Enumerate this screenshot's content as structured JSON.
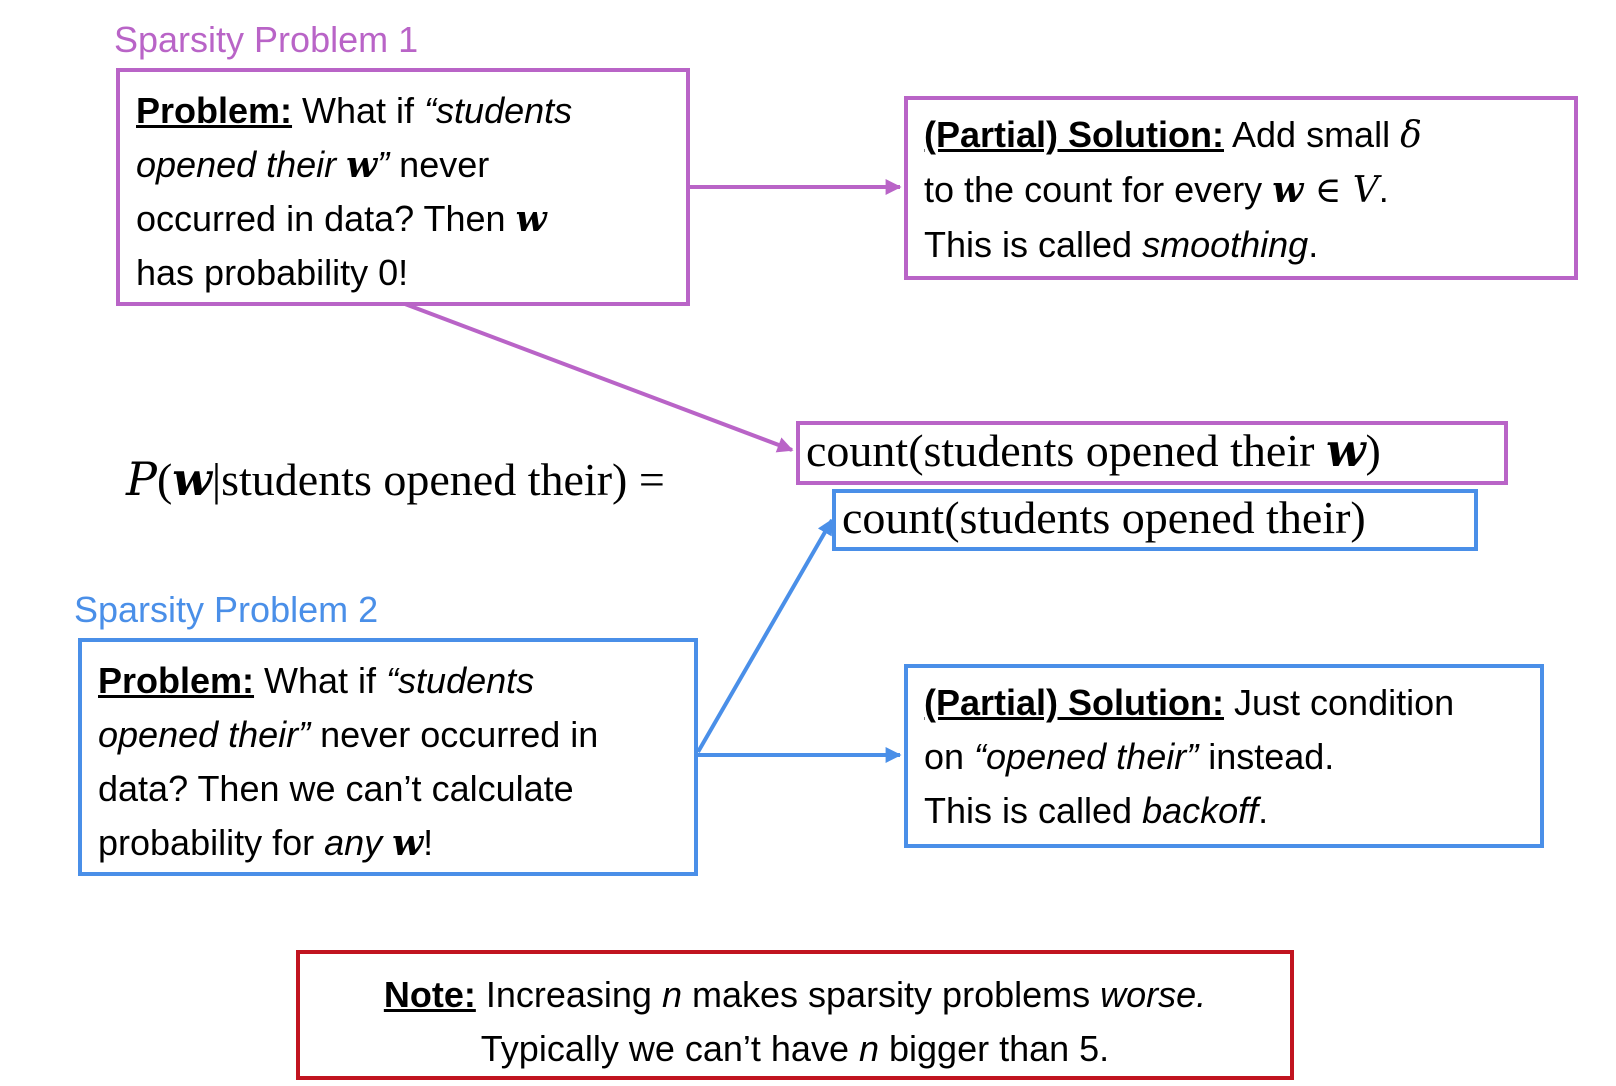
{
  "colors": {
    "problem1": "#b964c7",
    "problem2": "#4a8fe8",
    "note": "#c1141f"
  },
  "problem1": {
    "heading": "Sparsity Problem 1",
    "label": "Problem:",
    "t1": " What if ",
    "t2": "“students",
    "t3": "opened their ",
    "t4": "w",
    "t5": "”",
    "t6": " never",
    "t7": "occurred in data? Then ",
    "t8": "w",
    "t9": "has probability 0!"
  },
  "solution1": {
    "label": "(Partial) Solution:",
    "t1": " Add small ",
    "delta": "δ",
    "t2": "to the count for every ",
    "w": "w",
    "in": " ∈ ",
    "V": "V",
    "t3": ".",
    "t4": "This is called ",
    "t5": "smoothing",
    "t6": "."
  },
  "formula": {
    "P": "P",
    "open": "(",
    "w": "w",
    "given": "|students opened their) =",
    "numerator_text": "count(students opened their ",
    "numerator_w": "w",
    "numerator_close": ")",
    "denominator": "count(students opened their)"
  },
  "problem2": {
    "heading": "Sparsity Problem 2",
    "label": "Problem:",
    "t1": " What if ",
    "t2": "“students",
    "t3": "opened their”",
    "t4": " never occurred in",
    "t5": "data? Then we can’t calculate",
    "t6": "probability for ",
    "t7": "any",
    "t8": " ",
    "t9": "w",
    "t10": "!"
  },
  "solution2": {
    "label": "(Partial) Solution:",
    "t1": " Just condition",
    "t2": "on ",
    "t3": "“opened their”",
    "t4": " instead.",
    "t5": "This is called ",
    "t6": "backoff",
    "t7": "."
  },
  "note": {
    "label": "Note:",
    "t1": " Increasing ",
    "n1": "n",
    "t2": " makes sparsity problems ",
    "t3": "worse.",
    "t4": "Typically we can’t have ",
    "n2": "n",
    "t5": " bigger than 5."
  }
}
